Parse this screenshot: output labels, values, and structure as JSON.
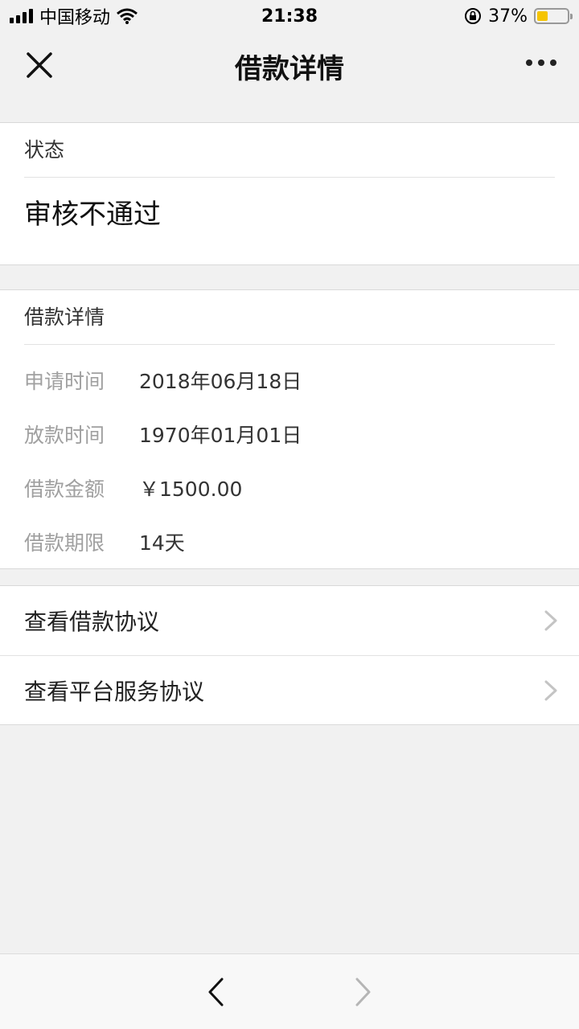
{
  "status_bar": {
    "carrier": "中国移动",
    "time": "21:38",
    "battery_pct": "37%",
    "battery_level": 0.37,
    "battery_color": "#f5c400"
  },
  "nav": {
    "title": "借款详情",
    "close_icon": "close-icon",
    "more_icon": "more-dots-icon"
  },
  "status_section": {
    "heading": "状态",
    "value": "审核不通过"
  },
  "detail_section": {
    "heading": "借款详情",
    "rows": [
      {
        "label": "申请时间",
        "value": "2018年06月18日"
      },
      {
        "label": "放款时间",
        "value": "1970年01月01日"
      },
      {
        "label": "借款金额",
        "value": "￥1500.00"
      },
      {
        "label": "借款期限",
        "value": "14天"
      }
    ]
  },
  "links": [
    {
      "label": "查看借款协议"
    },
    {
      "label": "查看平台服务协议"
    }
  ],
  "bottom_bar": {
    "back_icon": "back-arrow-icon",
    "forward_icon": "forward-arrow-icon"
  }
}
